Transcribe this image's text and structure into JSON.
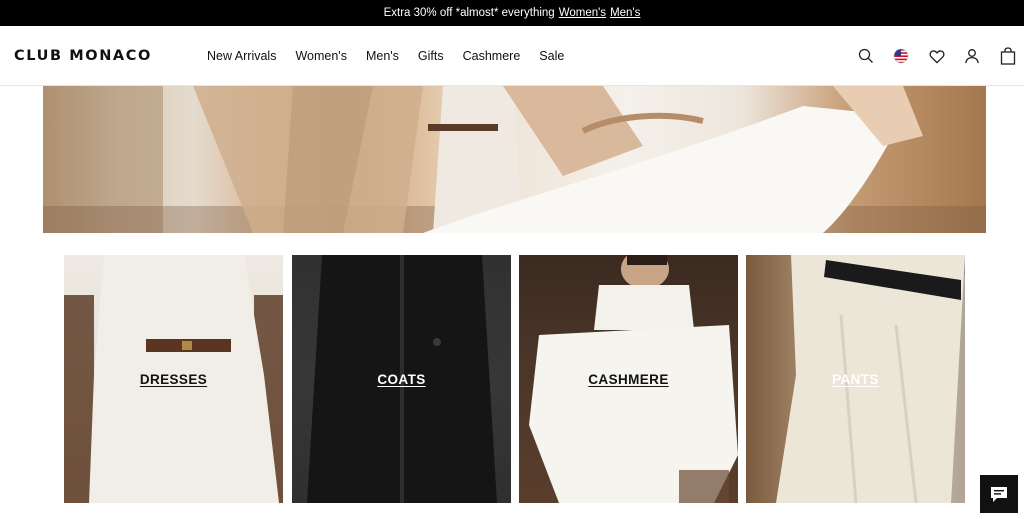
{
  "promo": {
    "text": "Extra 30% off *almost* everything",
    "links": [
      "Women's",
      "Men's"
    ]
  },
  "header": {
    "logo": "CLUB MONACO",
    "nav": [
      "New Arrivals",
      "Women's",
      "Men's",
      "Gifts",
      "Cashmere",
      "Sale"
    ],
    "icons": [
      "search-icon",
      "us-flag-icon",
      "heart-icon",
      "account-icon",
      "bag-icon"
    ]
  },
  "categories": [
    {
      "label": "DRESSES",
      "text_color": "#111111"
    },
    {
      "label": "COATS",
      "text_color": "#ffffff"
    },
    {
      "label": "CASHMERE",
      "text_color": "#111111"
    },
    {
      "label": "PANTS",
      "text_color": "#ffffff"
    }
  ],
  "chat": {
    "icon": "chat-icon"
  },
  "colors": {
    "promo_bg": "#000000",
    "text": "#111111",
    "background": "#ffffff"
  }
}
